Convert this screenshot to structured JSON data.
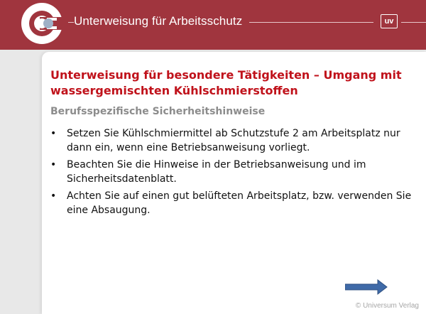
{
  "header": {
    "title": "Unterweisung für Arbeitsschutz",
    "badge": "uv"
  },
  "slide": {
    "title": "Unterweisung für besondere Tätigkeiten – Umgang mit wassergemischten Kühlschmierstoffen",
    "subtitle": "Berufsspezifische Sicherheitshinweise",
    "bullets": [
      "Setzen Sie Kühlschmiermittel ab Schutzstufe 2 am Arbeitsplatz nur dann ein, wenn eine Betriebsanweisung vorliegt.",
      "Beachten Sie die Hinweise in der Betriebsanweisung und im Sicherheitsdatenblatt.",
      "Achten Sie auf einen gut belüfteten Arbeitsplatz, bzw. verwenden Sie eine Absaugung."
    ],
    "bullet_glyph": "•",
    "next_icon": "arrow-right-icon",
    "copyright": "© Universum Verlag"
  },
  "colors": {
    "header_bg": "#a0353e",
    "title_red": "#c0121b",
    "subtitle_gray": "#8c8c8c",
    "arrow_blue": "#3f6aa8"
  }
}
